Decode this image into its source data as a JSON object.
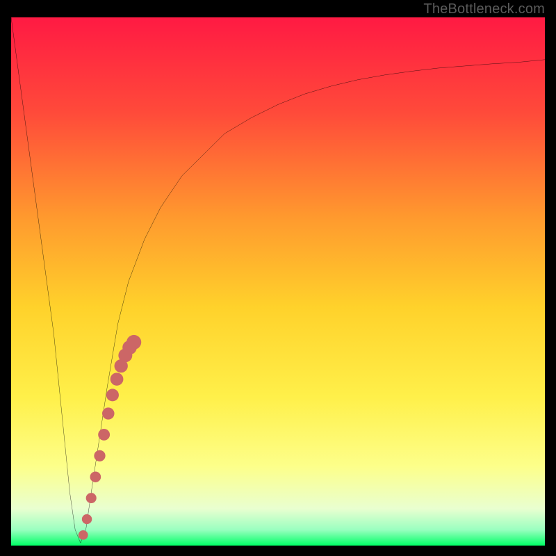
{
  "watermark": "TheBottleneck.com",
  "colors": {
    "gradient_top": "#ff1a43",
    "gradient_mid_upper": "#ff7a2e",
    "gradient_mid": "#ffd22b",
    "gradient_mid_lower": "#fff46a",
    "gradient_low": "#f6ffb0",
    "gradient_bottom": "#00ff66",
    "curve": "#000000",
    "marker": "#cc6666",
    "frame": "#000000"
  },
  "chart_data": {
    "type": "line",
    "title": "",
    "xlabel": "",
    "ylabel": "",
    "xlim": [
      0,
      100
    ],
    "ylim": [
      0,
      100
    ],
    "series": [
      {
        "name": "bottleneck-curve",
        "x": [
          0,
          2,
          4,
          6,
          8,
          10,
          11,
          12,
          13,
          14,
          15,
          18,
          20,
          22,
          25,
          28,
          32,
          36,
          40,
          45,
          50,
          55,
          60,
          65,
          70,
          75,
          80,
          85,
          90,
          95,
          100
        ],
        "values": [
          100,
          85,
          70,
          55,
          40,
          20,
          10,
          3,
          0.5,
          3,
          10,
          30,
          42,
          50,
          58,
          64,
          70,
          74,
          78,
          81,
          83.5,
          85.5,
          87,
          88.2,
          89.1,
          89.8,
          90.4,
          90.8,
          91.2,
          91.5,
          92
        ]
      }
    ],
    "markers": {
      "name": "highlight-segment",
      "x": [
        13.5,
        14.2,
        15.0,
        15.8,
        16.6,
        17.4,
        18.2,
        19.0,
        19.8,
        20.6,
        21.4,
        22.2,
        23.0
      ],
      "values": [
        2,
        5,
        9,
        13,
        17,
        21,
        25,
        28.5,
        31.5,
        34,
        36,
        37.5,
        38.5
      ]
    }
  }
}
